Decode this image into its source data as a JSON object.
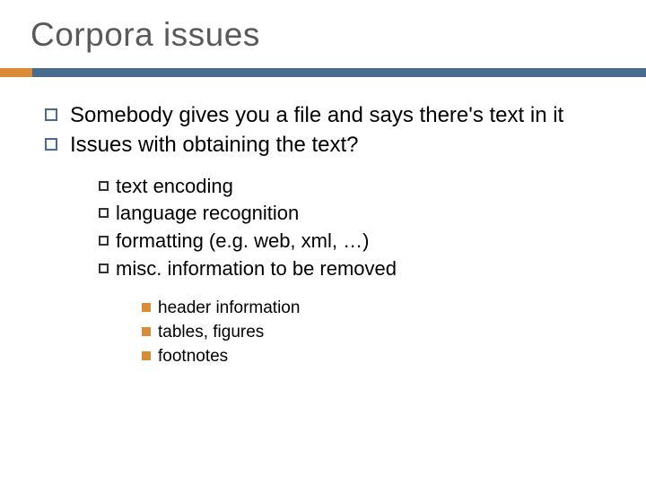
{
  "title": "Corpora issues",
  "bullets": [
    {
      "text": "Somebody gives you a file and says there's text in it"
    },
    {
      "text": "Issues with obtaining the text?"
    }
  ],
  "sub_bullets": [
    {
      "text": "text encoding"
    },
    {
      "text": "language recognition"
    },
    {
      "text": "formatting (e.g. web, xml, …)"
    },
    {
      "text": "misc. information to be removed"
    }
  ],
  "sub_sub_bullets": [
    {
      "text": "header information"
    },
    {
      "text": "tables, figures"
    },
    {
      "text": "footnotes"
    }
  ],
  "colors": {
    "accent_orange": "#d98b38",
    "accent_blue": "#4a6b90",
    "title_gray": "#595959"
  }
}
